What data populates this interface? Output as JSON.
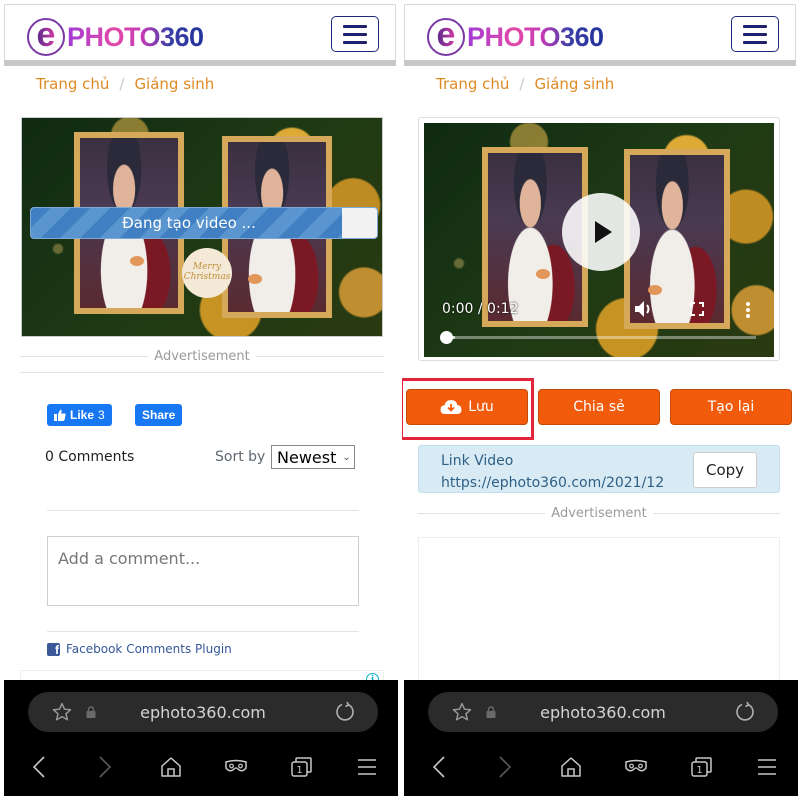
{
  "site": {
    "logo_e": "e",
    "logo_text": "PHOTO360",
    "menu_icon": "hamburger-icon"
  },
  "breadcrumb": {
    "home": "Trang chủ",
    "separator": "/",
    "current": "Giáng sinh"
  },
  "left": {
    "preview": {
      "merry_text": "Merry Christmas",
      "progress_label": "Đang tạo video ...",
      "progress_percent": 90
    },
    "ad_label": "Advertisement",
    "facebook": {
      "like_label": "Like",
      "like_count": "3",
      "share_label": "Share",
      "comments_count": "0 Comments",
      "sort_label": "Sort by",
      "sort_value": "Newest",
      "comment_placeholder": "Add a comment...",
      "plugin_label": "Facebook Comments Plugin"
    },
    "ad_info_icon": "i"
  },
  "right": {
    "player": {
      "time": "0:00 / 0:12",
      "played_fraction": 0.0,
      "buffered_fraction": 0.03
    },
    "actions": {
      "save_label": "Lưu",
      "share_label": "Chia sẻ",
      "recreate_label": "Tạo lại"
    },
    "link": {
      "label": "Link Video",
      "url": "https://ephoto360.com/2021/12",
      "copy_label": "Copy"
    },
    "ad_label": "Advertisement"
  },
  "browser": {
    "url": "ephoto360.com",
    "tab_count": "1"
  },
  "colors": {
    "accent_orange": "#f35b0c",
    "breadcrumb_orange": "#e08a22",
    "facebook_blue": "#1877f2",
    "highlight_red": "#e3243b",
    "progress_blue": "#3f7fc2"
  }
}
